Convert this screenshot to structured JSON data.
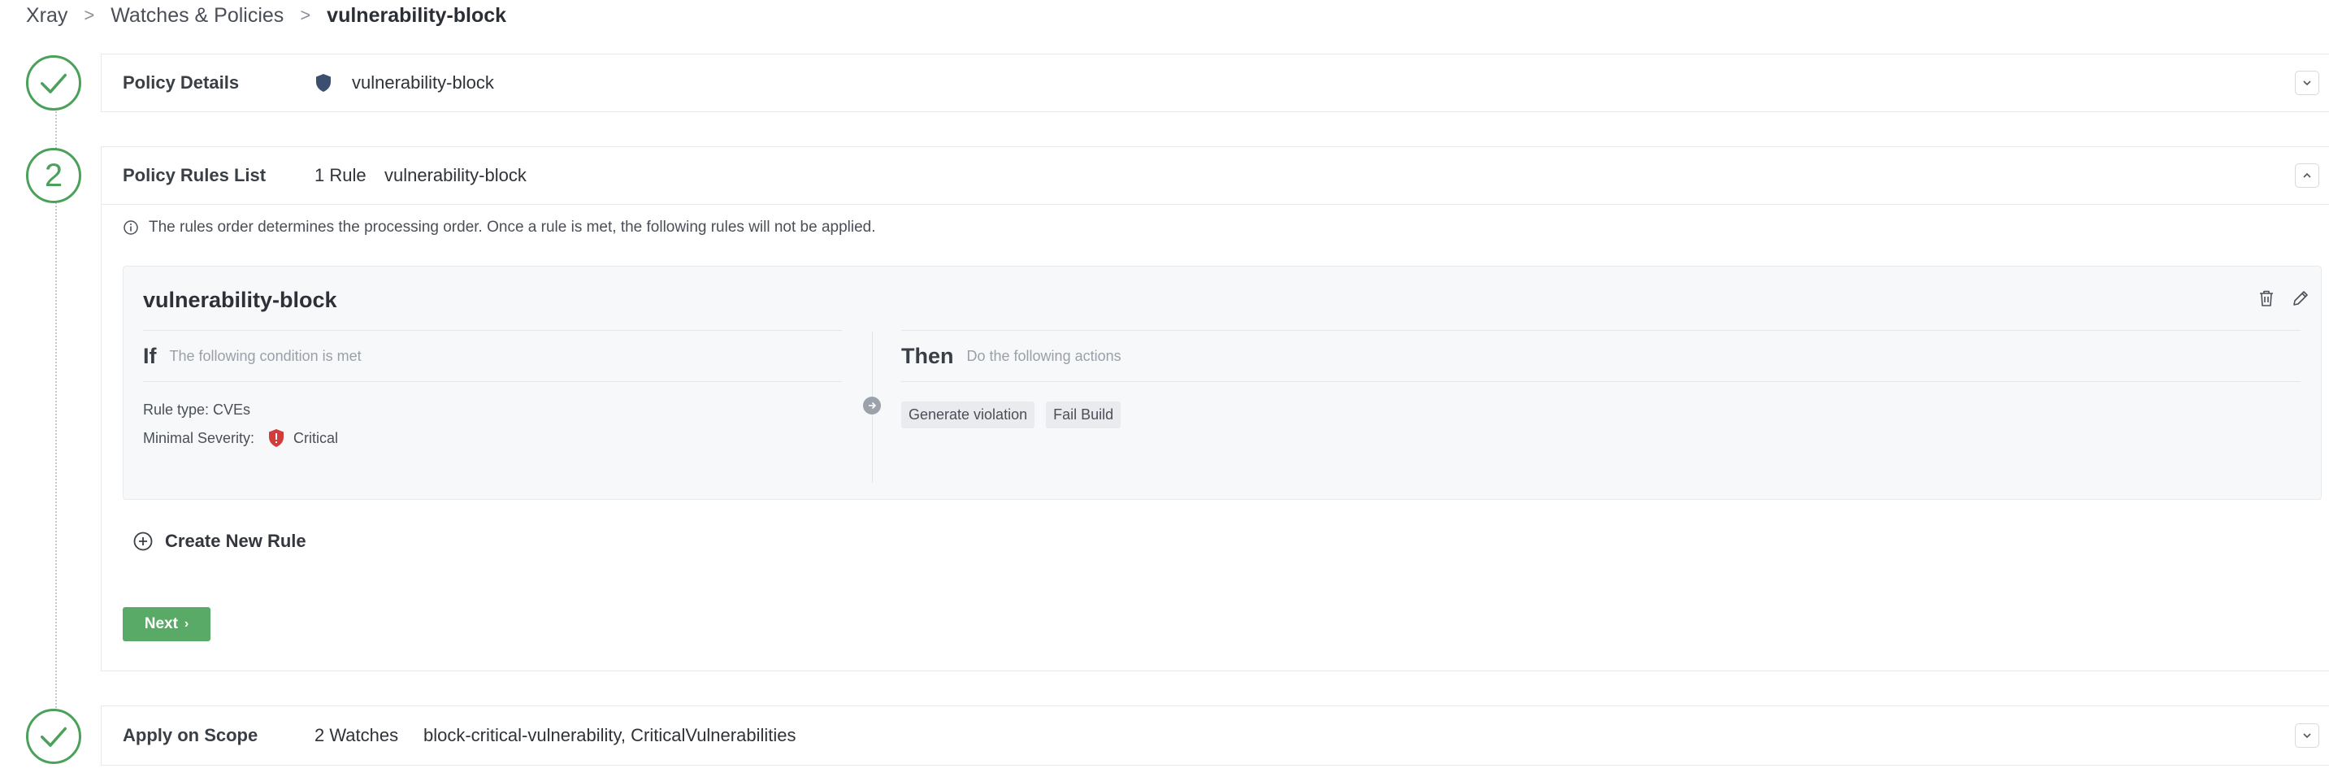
{
  "breadcrumb": {
    "items": [
      "Xray",
      "Watches & Policies",
      "vulnerability-block"
    ],
    "separator": ">"
  },
  "steps": {
    "step1": {
      "state": "complete",
      "icon": "check-icon"
    },
    "step2": {
      "label": "2",
      "state": "active"
    },
    "step3": {
      "state": "complete",
      "icon": "check-icon"
    }
  },
  "policy_details": {
    "title": "Policy Details",
    "policy_name": "vulnerability-block",
    "icon": "shield-icon",
    "expanded": false
  },
  "rules_list": {
    "title": "Policy Rules List",
    "rule_count": "1 Rule",
    "rule_name": "vulnerability-block",
    "expanded": true,
    "info_text": "The rules order determines the processing order. Once a rule is met, the following rules will not be applied.",
    "rules": [
      {
        "name": "vulnerability-block",
        "if_label": "If",
        "if_sub": "The following condition is met",
        "rule_type": "Rule type: CVEs",
        "min_severity_label": "Minimal Severity:",
        "min_severity_value": "Critical",
        "then_label": "Then",
        "then_sub": "Do the following actions",
        "actions": [
          "Generate violation",
          "Fail Build"
        ]
      }
    ],
    "create_rule_label": "Create New Rule",
    "next_label": "Next"
  },
  "scope": {
    "title": "Apply on Scope",
    "watch_count": "2 Watches",
    "watches": "block-critical-vulnerability, CriticalVulnerabilities",
    "expanded": false
  },
  "colors": {
    "accent_green": "#4ba15a",
    "button_green": "#5aaa67",
    "critical_red": "#d13c3c",
    "shield_navy": "#3d4f6e"
  }
}
